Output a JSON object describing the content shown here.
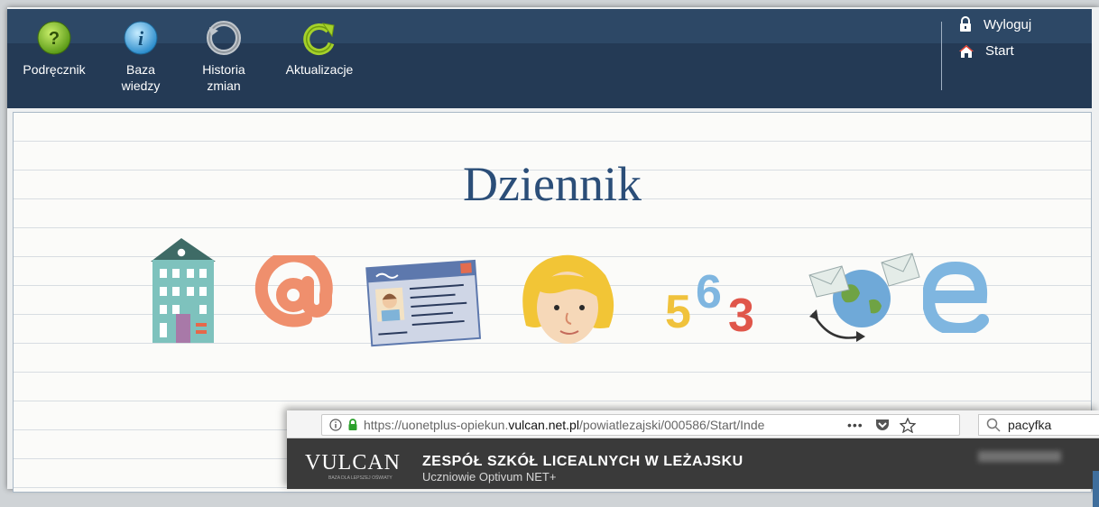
{
  "toolbar": {
    "items": [
      {
        "label": "Podręcznik",
        "icon": "help-icon"
      },
      {
        "label": "Baza\nwiedzy",
        "icon": "info-icon"
      },
      {
        "label": "Historia\nzmian",
        "icon": "history-icon"
      },
      {
        "label": "Aktualizacje",
        "icon": "refresh-icon"
      }
    ],
    "logout": "Wyloguj",
    "start": "Start"
  },
  "main": {
    "title": "Dziennik"
  },
  "digits": {
    "d1": "5",
    "d2": "6",
    "d3": "3"
  },
  "browser": {
    "url_prefix": "https://uonetplus-opiekun.",
    "url_domain": "vulcan.net.pl",
    "url_path": "/powiatlezajski/000586/Start/Inde",
    "search_text": "pacyfka"
  },
  "vulcan": {
    "logo": "VULCAN",
    "logo_sub": "BAZA DLA LEPSZEJ OŚWIATY",
    "school_name": "ZESPÓŁ SZKÓŁ LICEALNYCH W LEŻAJSKU",
    "product": "Uczniowie Optivum NET+"
  },
  "colors": {
    "header": "#243a55",
    "title": "#2b4e78",
    "vulcan_bar": "#3a3a3a"
  }
}
